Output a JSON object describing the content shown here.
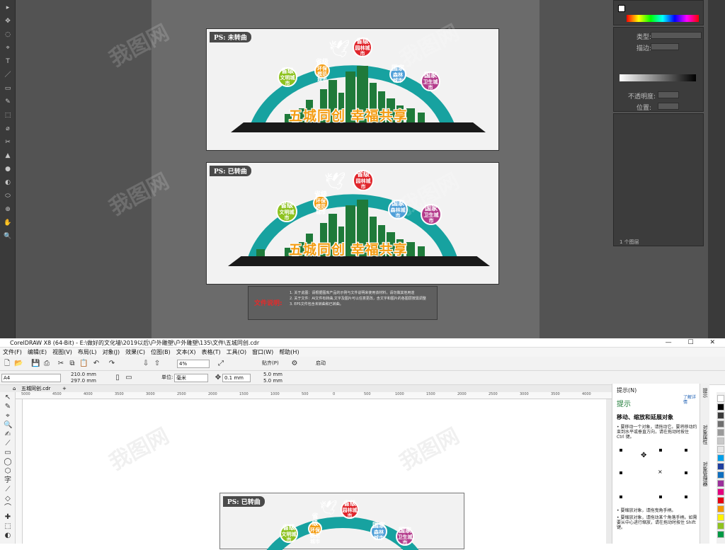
{
  "photoshop": {
    "tools": [
      "▸",
      "✥",
      "◌",
      "⌖",
      "T",
      "／",
      "▭",
      "✎",
      "⬚",
      "⌀",
      "✂",
      "▲",
      "●",
      "◐",
      "⬭",
      "⊕",
      "✋",
      "🔍"
    ],
    "artboards": [
      {
        "label": "PS: 未转曲"
      },
      {
        "label": "PS: 已转曲"
      }
    ],
    "design": {
      "slogan": "五城同创 幸福共享",
      "badges": [
        {
          "l1": "省级",
          "l2": "文明城市",
          "color": "#8dc21f"
        },
        {
          "l1": "省级",
          "l2": "环保模范城市",
          "color": "#f39c12"
        },
        {
          "l1": "省级",
          "l2": "园林城市",
          "color": "#e0262c"
        },
        {
          "l1": "国家",
          "l2": "森林城市",
          "color": "#4f9fd8"
        },
        {
          "l1": "国家",
          "l2": "卫生城市",
          "color": "#b43c8c"
        }
      ],
      "arc_color": "#17a2a0",
      "building_color": "#1f7a3a"
    },
    "note": {
      "title": "文件说明:",
      "lines": [
        "1. 关于此图：请根据图库产品的示例与文件说明来使用该材料，请勿做其他用途",
        "2. 关于文件：AI文件有转曲,文字及图片可以任意更改，含文字和图片的各图层按需调整",
        "3. EPS文件包含未转曲和已转曲。"
      ]
    },
    "right_panel": {
      "type_label": "类型:",
      "fill_label": "描边:",
      "opacity_label": "不透明度:",
      "position_label": "位置:",
      "layers_count": "1 个图层"
    }
  },
  "coreldraw": {
    "title": "CorelDRAW X8 (64-Bit) - E:\\做好的文化墙\\2019以后\\户外雕塑\\户外雕塑\\135\\文件\\五城同创.cdr",
    "menu": [
      "文件(F)",
      "编辑(E)",
      "视图(V)",
      "布局(L)",
      "对象(J)",
      "效果(C)",
      "位图(B)",
      "文本(X)",
      "表格(T)",
      "工具(O)",
      "窗口(W)",
      "帮助(H)"
    ],
    "toolbar": {
      "zoom": "4%",
      "snap_label": "贴齐(P)",
      "launch_label": "启动"
    },
    "propbar": {
      "page_size": "A4",
      "width": "210.0 mm",
      "height": "297.0 mm",
      "units_label": "单位:",
      "units_value": "毫米",
      "nudge": "0.1 mm",
      "dup_x": "5.0 mm",
      "dup_y": "5.0 mm"
    },
    "doc_tab": "五城同创.cdr",
    "ruler_numbers": [
      "5000",
      "4500",
      "4000",
      "3500",
      "3000",
      "2500",
      "2000",
      "1500",
      "1000",
      "500",
      "0",
      "500",
      "1000",
      "1500",
      "2000",
      "2500",
      "3000",
      "3500",
      "4000"
    ],
    "artboard_label": "PS: 已转曲",
    "hint": {
      "header": "提示(N)",
      "title": "提示",
      "link": "了解详情",
      "subtitle": "移动、缩放和延展对象",
      "text1": "• 要移动一个对象，请拖动它。要将移动约束到水平或垂直方向，请在拖动时按住 Ctrl 键。",
      "text2": "• 要缩放对象，请拖曳角手柄。",
      "text3": "• 要缩放对象，请拖动某个角落手柄。如需要从中心进行缩放，请在拖动时按住 Shift 键。"
    },
    "docker_tabs": [
      "提示",
      "对象属性",
      "对象管理器"
    ],
    "palette": [
      "#ffffff",
      "#000000",
      "#3a3a3a",
      "#6f6f6f",
      "#9a9a9a",
      "#c8c8c8",
      "#e6e6e6",
      "#00a0e9",
      "#1f3f9f",
      "#0f6fbf",
      "#9b2f9b",
      "#e4007f",
      "#e60012",
      "#f39800",
      "#fff100",
      "#8fc31f",
      "#009944"
    ]
  },
  "watermark": "我图网"
}
